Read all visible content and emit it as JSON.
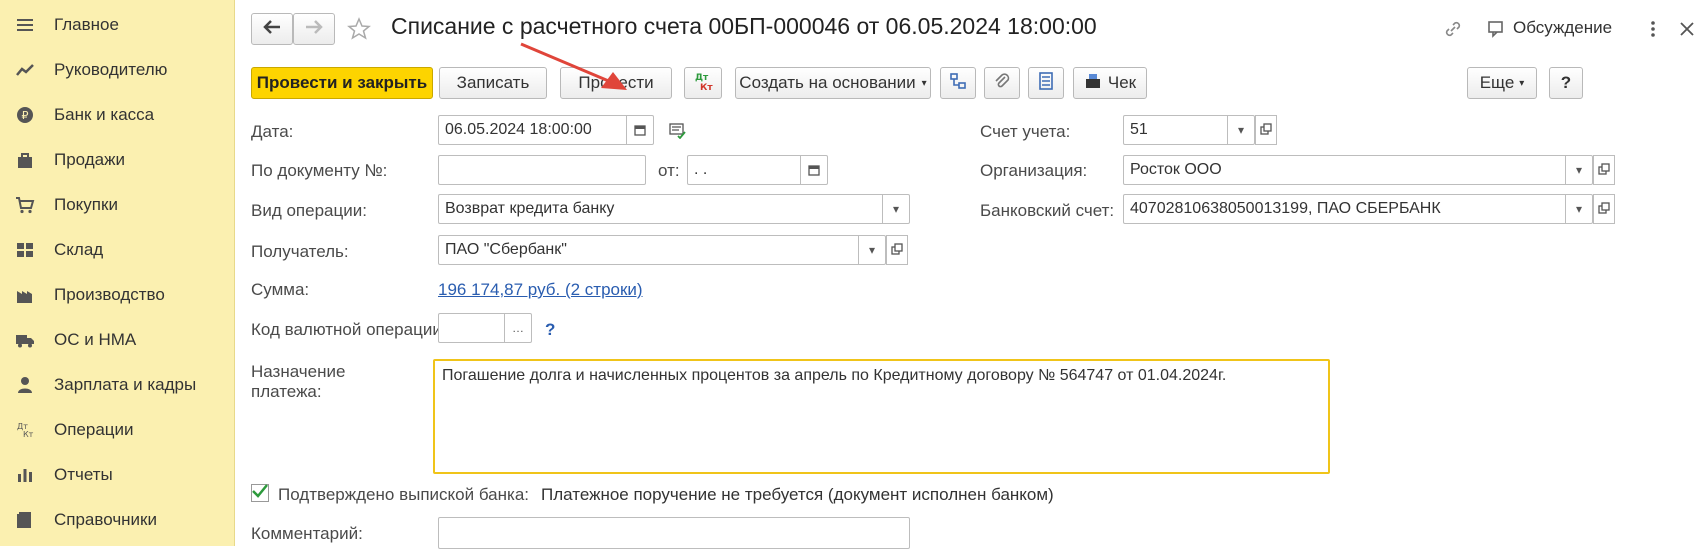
{
  "sidebar": {
    "items": [
      {
        "label": "Главное",
        "icon": "menu-icon"
      },
      {
        "label": "Руководителю",
        "icon": "trend-icon"
      },
      {
        "label": "Банк и касса",
        "icon": "ruble-coin-icon"
      },
      {
        "label": "Продажи",
        "icon": "shopping-bag-icon"
      },
      {
        "label": "Покупки",
        "icon": "cart-icon"
      },
      {
        "label": "Склад",
        "icon": "grid-warehouse-icon"
      },
      {
        "label": "Производство",
        "icon": "factory-icon"
      },
      {
        "label": "ОС и НМА",
        "icon": "truck-icon"
      },
      {
        "label": "Зарплата и кадры",
        "icon": "person-icon"
      },
      {
        "label": "Операции",
        "icon": "dt-kt-icon"
      },
      {
        "label": "Отчеты",
        "icon": "bar-chart-icon"
      },
      {
        "label": "Справочники",
        "icon": "book-icon"
      }
    ]
  },
  "header": {
    "title": "Списание с расчетного счета 00БП-000046 от 06.05.2024 18:00:00",
    "discussion_label": "Обсуждение"
  },
  "toolbar": {
    "post_close_label": "Провести и закрыть",
    "save_label": "Записать",
    "post_label": "Провести",
    "dt_kt_label": "Дт Кт",
    "create_based_label": "Создать на основании",
    "receipt_label": "Чек",
    "more_label": "Еще",
    "help_label": "?"
  },
  "form": {
    "date_label": "Дата:",
    "date_value": "06.05.2024 18:00:00",
    "doc_no_label": "По документу №:",
    "doc_no_value": "",
    "from_label": "от:",
    "from_value": " .  .",
    "operation_label": "Вид операции:",
    "operation_value": "Возврат кредита банку",
    "recipient_label": "Получатель:",
    "recipient_value": "ПАО \"Сбербанк\"",
    "sum_label": "Сумма:",
    "sum_value": "196 174,87 руб. (2 строки)",
    "currency_op_label": "Код валютной операции:",
    "currency_op_value": "",
    "currency_help": "?",
    "purpose_label_1": "Назначение",
    "purpose_label_2": "платежа:",
    "purpose_value": "Погашение долга и начисленных процентов за апрель по Кредитному договору № 564747 от 01.04.2024г.",
    "confirmed_label": "Подтверждено выпиской банка:",
    "confirmed_checked": true,
    "confirmed_note": "Платежное поручение не требуется (документ исполнен банком)",
    "comment_label": "Комментарий:",
    "comment_value": "",
    "account_label": "Счет учета:",
    "account_value": "51",
    "org_label": "Организация:",
    "org_value": "Росток ООО",
    "bank_account_label": "Банковский счет:",
    "bank_account_value": "40702810638050013199, ПАО СБЕРБАНК"
  },
  "colors": {
    "sidebar_bg": "#fbf0b0",
    "primary_button": "#fdd400",
    "link": "#2a5db0",
    "focus_border": "#f0c419",
    "annotation_arrow": "#e0453a"
  }
}
